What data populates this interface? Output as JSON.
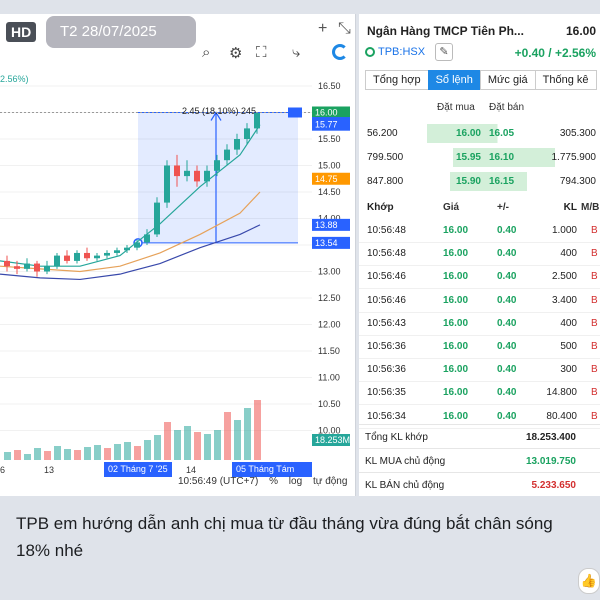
{
  "badges": {
    "hd": "HD",
    "date": "T2 28/07/2025"
  },
  "toolbar": {
    "top_icons": [
      "plus-icon",
      "collapse-icon"
    ],
    "icons": [
      "zoom-icon",
      "settings-icon",
      "fullscreen-icon",
      "share-icon",
      "logo-icon"
    ]
  },
  "chart": {
    "change_label": "2.56%)",
    "measure_label": "2.45 (18.10%) 245",
    "axis_ticks": [
      "16.50",
      "16.00",
      "15.50",
      "15.00",
      "14.50",
      "14.00",
      "13.50",
      "13.00",
      "12.50",
      "12.00",
      "11.50",
      "11.00",
      "10.50",
      "10.00"
    ],
    "price_tags": [
      {
        "text": "16.00",
        "color": "#1aa260"
      },
      {
        "text": "15.99",
        "color": "#2962ff"
      },
      {
        "text": "15.77",
        "color": "#2962ff"
      },
      {
        "text": "14.75",
        "color": "#ff9800"
      },
      {
        "text": "13.88",
        "color": "#2962ff"
      },
      {
        "text": "13.54",
        "color": "#2962ff"
      },
      {
        "text": "18.253M",
        "color": "#26a69a"
      }
    ],
    "x_labels": {
      "l1": "6",
      "l2": "13",
      "l3": "02 Tháng 7 '25",
      "l4": "14",
      "l5": "05 Tháng Tám '25"
    },
    "footer": {
      "time": "10:56:49 (UTC+7)",
      "pct": "%",
      "log": "log",
      "auto": "tự động"
    }
  },
  "book": {
    "title": "Ngân Hàng TMCP Tiên Ph...",
    "price": "16.00",
    "symbol": "TPB:HSX",
    "change": "+0.40 / +2.56%",
    "tabs": [
      "Tổng hợp",
      "Sổ lệnh",
      "Mức giá",
      "Thống kê"
    ],
    "active_tab": 1,
    "ob_headers": {
      "bid": "Đặt mua",
      "ask": "Đặt bán"
    },
    "orderbook": [
      {
        "bid_vol": "56.200",
        "bid": "16.00",
        "ask": "16.05",
        "ask_vol": "305.300"
      },
      {
        "bid_vol": "799.500",
        "bid": "15.95",
        "ask": "16.10",
        "ask_vol": "1.775.900"
      },
      {
        "bid_vol": "847.800",
        "bid": "15.90",
        "ask": "16.15",
        "ask_vol": "794.300"
      }
    ],
    "trade_headers": {
      "time": "Khớp",
      "price": "Giá",
      "chg": "+/-",
      "vol": "KL",
      "side": "M/B"
    },
    "trades": [
      {
        "time": "10:56:48",
        "price": "16.00",
        "chg": "0.40",
        "vol": "1.000",
        "side": "B"
      },
      {
        "time": "10:56:48",
        "price": "16.00",
        "chg": "0.40",
        "vol": "400",
        "side": "B"
      },
      {
        "time": "10:56:46",
        "price": "16.00",
        "chg": "0.40",
        "vol": "2.500",
        "side": "B"
      },
      {
        "time": "10:56:46",
        "price": "16.00",
        "chg": "0.40",
        "vol": "3.400",
        "side": "B"
      },
      {
        "time": "10:56:43",
        "price": "16.00",
        "chg": "0.40",
        "vol": "400",
        "side": "B"
      },
      {
        "time": "10:56:36",
        "price": "16.00",
        "chg": "0.40",
        "vol": "500",
        "side": "B"
      },
      {
        "time": "10:56:36",
        "price": "16.00",
        "chg": "0.40",
        "vol": "300",
        "side": "B"
      },
      {
        "time": "10:56:35",
        "price": "16.00",
        "chg": "0.40",
        "vol": "14.800",
        "side": "B"
      },
      {
        "time": "10:56:34",
        "price": "16.00",
        "chg": "0.40",
        "vol": "80.400",
        "side": "B"
      }
    ],
    "summary": [
      {
        "label": "Tổng KL khớp",
        "value": "18.253.400",
        "color": "#222222"
      },
      {
        "label": "KL MUA chủ động",
        "value": "13.019.750",
        "color": "#1aa260"
      },
      {
        "label": "KL BÁN chủ động",
        "value": "5.233.650",
        "color": "#d32f2f"
      }
    ]
  },
  "message": {
    "text": "TPB em hướng dẫn anh chị mua từ đầu tháng vừa đúng bắt chân sóng 18% nhé"
  },
  "colors": {
    "up": "#26a69a",
    "down": "#ef5350",
    "accent": "#2962ff"
  }
}
